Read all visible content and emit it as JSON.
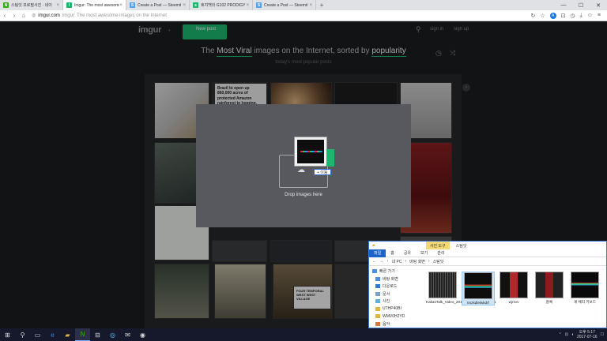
{
  "browser": {
    "tabs": [
      {
        "label": "스팀잇 프로필사진 · 네이",
        "fav": "N",
        "color": "#2db400",
        "active": false
      },
      {
        "label": "Imgur: The most awesome",
        "fav": "I",
        "color": "#1bb76e",
        "active": true
      },
      {
        "label": "Create a Post — Steemit",
        "fav": "S",
        "color": "#4ba2f2",
        "active": false
      },
      {
        "label": "휴지백의 G102 PRODIGY",
        "fav": "s",
        "color": "#1bb76e",
        "active": false
      },
      {
        "label": "Create a Post — Steemit",
        "fav": "S",
        "color": "#4ba2f2",
        "active": false
      }
    ],
    "new_tab": "+",
    "win_controls": [
      "—",
      "☐",
      "✕"
    ],
    "back": "‹",
    "forward": "›",
    "home": "⌂",
    "url_host": "imgur.com",
    "url_title": "imgur: The most awesome images on the Internet",
    "profile_letter": "A"
  },
  "imgur": {
    "logo": "imgur",
    "logo_caret": "▾",
    "new_post": "New post",
    "sign_in": "sign in",
    "sign_up": "sign up",
    "tagline": {
      "pre": "The",
      "sort": "Most Viral",
      "mid": "images on the Internet, sorted by",
      "by": "popularity"
    },
    "subtitle": "today's most popular posts",
    "text_card": "Brazil to open up 860,000 acres of protected Amazon rainforest to logging, mining and",
    "sign_text": "FOUR TEMPORAL WEST WEST VILLAGE"
  },
  "upload_modal": {
    "drop_label": "Drop images here",
    "move_tip": "+ 이동"
  },
  "explorer": {
    "context_tab": "사진 도구",
    "window_title": "스팀잇",
    "ribbon": [
      "파일",
      "홈",
      "공유",
      "보기",
      "관리"
    ],
    "path": [
      "내 PC",
      "바탕 화면",
      "스팀잇"
    ],
    "sidebar": [
      "빠른 가기",
      "바탕 화면",
      "다운로드",
      "문서",
      "사진",
      "UTHP40BI",
      "WMV0H2YD",
      "음악"
    ],
    "files": [
      {
        "name": "KakaoTalk_Video_20170715_1858_48_711",
        "selected": false
      },
      {
        "name": "tmzkdlelwkdrf",
        "selected": true
      },
      {
        "name": "wjrzvv",
        "selected": false
      },
      {
        "name": "잘록",
        "selected": false
      },
      {
        "name": "게 체리 키보드",
        "selected": false
      }
    ]
  },
  "taskbar": {
    "time": "오후 5:17",
    "date": "2017-07-16"
  }
}
